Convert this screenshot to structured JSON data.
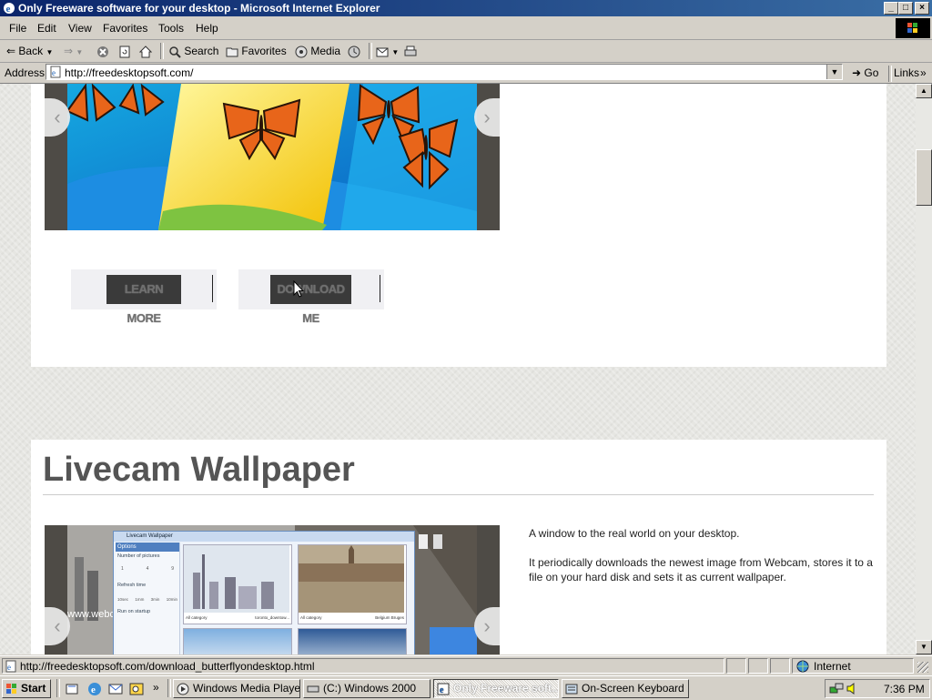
{
  "window": {
    "title": "Only Freeware software for your desktop - Microsoft Internet Explorer",
    "controls": {
      "minimize": "_",
      "maximize": "□",
      "close": "×"
    }
  },
  "menu": {
    "items": [
      "File",
      "Edit",
      "View",
      "Favorites",
      "Tools",
      "Help"
    ]
  },
  "toolbar": {
    "back": "Back",
    "search": "Search",
    "favorites": "Favorites",
    "media": "Media"
  },
  "address": {
    "label": "Address",
    "url": "http://freedesktopsoft.com/",
    "go": "Go",
    "links": "Links"
  },
  "page": {
    "card1": {
      "learn_more": "LEARN MORE",
      "download": "DOWNLOAD ME"
    },
    "card2": {
      "title": "Livecam Wallpaper",
      "desc1": "A window to the real world on your desktop.",
      "desc2": "It periodically downloads the newest image from Webcam, stores it to a file on your hard disk and sets it as current wallpaper.",
      "screenshot": {
        "window_title": "Livecam Wallpaper",
        "sidebar_header": "Options",
        "number_of_pictures": "Number of pictures",
        "pic_counts": [
          "1",
          "4",
          "9"
        ],
        "refresh_time": "Refresh time",
        "refresh_options": [
          "10sec",
          "1mm",
          "3min",
          "10min"
        ],
        "run_on_startup": "Run on startup",
        "tile1_category": "All category",
        "tile1_name": "toronto_downtow...",
        "tile2_category": "All category",
        "tile2_name": "Belgium Bruges",
        "watermark": "www.webcams..."
      }
    }
  },
  "statusbar": {
    "url": "http://freedesktopsoft.com/download_butterflyondesktop.html",
    "zone": "Internet"
  },
  "taskbar": {
    "start": "Start",
    "tasks": [
      "Windows Media Player",
      "(C:) Windows 2000",
      "Only Freeware soft...",
      "On-Screen Keyboard"
    ],
    "clock": "7:36 PM"
  },
  "colors": {
    "title_gradient_start": "#0a246a",
    "title_gradient_end": "#3a6ea5",
    "chrome": "#d4d0c8",
    "heading": "#555555"
  }
}
